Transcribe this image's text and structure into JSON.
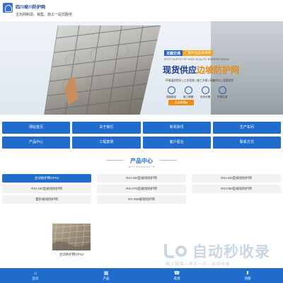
{
  "header": {
    "site_name": "四川坡川防护网",
    "tagline": "主治网制造、销售、施工一站式服务"
  },
  "banner": {
    "brand_name": "龙巅交通",
    "brand_slogan": "厂家供应|品质保障",
    "brand_sub": "SPOT SUPPLY OF HIGH QUALITY BARRIER SHOW",
    "headline_prefix": "现货供应",
    "headline_highlight": "边坡防护网",
    "features_text": "环境适应性好 | 工艺优良 | 施工方便 | 网格均匀 | 全国发货",
    "features": [
      {
        "label": "性能稳定",
        "icon": "shield-icon"
      },
      {
        "label": "施工便捷",
        "icon": "tools-icon"
      },
      {
        "label": "安全可靠",
        "icon": "lock-icon"
      },
      {
        "label": "不易生锈",
        "icon": "drop-icon"
      }
    ],
    "cta": "点击查看▶"
  },
  "nav": [
    "网站首页",
    "关于我们",
    "新闻资讯",
    "生产车间",
    "产品中心",
    "工程案例",
    "客户留言",
    "联系方式"
  ],
  "products": {
    "title": "产品中心",
    "subtitle": "HOT PRODUCTS",
    "categories": [
      {
        "label": "主动防护网GPS2",
        "active": true
      },
      {
        "label": "RXI-200型被动防护网",
        "active": false
      },
      {
        "label": "RXI-150型被动防护网",
        "active": false
      },
      {
        "label": "RXI-100型被动防护网",
        "active": false
      },
      {
        "label": "RXI-075型被动防护网",
        "active": false
      },
      {
        "label": "RXI-050型被动防护网",
        "active": false
      },
      {
        "label": "菱形被动防护网",
        "active": false
      },
      {
        "label": "RX-050被动防护网",
        "active": false
      }
    ],
    "card_name": "主动防护网GPS2"
  },
  "watermark": {
    "text": "自动秒收录",
    "sub": "做上链接—来访一次—自动收录"
  },
  "bottom_bar": [
    {
      "label": "首页",
      "icon": "home-icon"
    },
    {
      "label": "产品",
      "icon": "grid-icon"
    },
    {
      "label": "电话",
      "icon": "phone-icon"
    },
    {
      "label": "顶部",
      "icon": "arrow-up-icon"
    }
  ],
  "colors": {
    "primary": "#1f6ccc",
    "accent": "#f28c12",
    "headline": "#1c3a8a"
  }
}
